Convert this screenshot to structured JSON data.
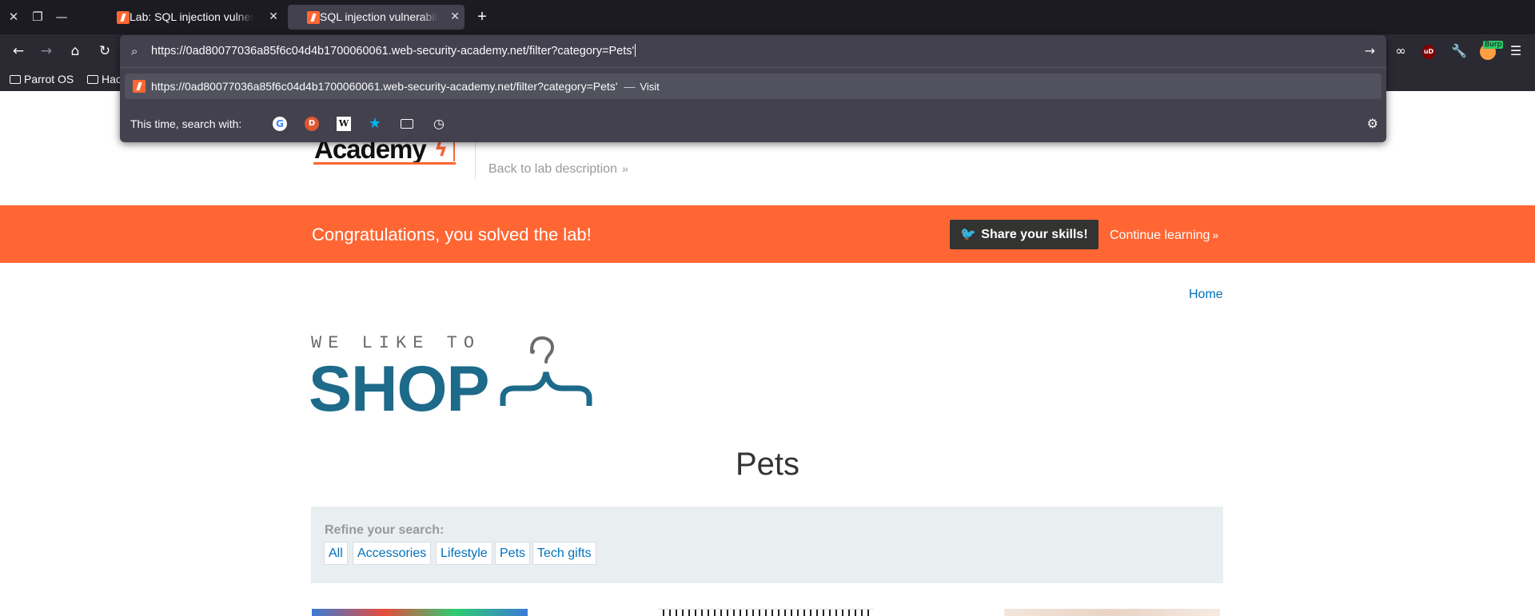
{
  "browser": {
    "tabs": [
      {
        "title": "Lab: SQL injection vulnerability in WHERE clause",
        "active": false
      },
      {
        "title": "SQL injection vulnerability in WHERE clause",
        "active": true
      }
    ],
    "url": "https://0ad80077036a85f6c04d4b1700060061.web-security-academy.net/filter?category=Pets'",
    "suggestion": {
      "url": "https://0ad80077036a85f6c04d4b1700060061.web-security-academy.net/filter?category=Pets'",
      "separator": "—",
      "action": "Visit"
    },
    "search_with_label": "This time, search with:",
    "engines": [
      "google-icon",
      "duckduckgo-icon",
      "wikipedia-icon",
      "bookmarks-star-icon",
      "tabs-icon",
      "history-icon"
    ],
    "bookmarks": [
      {
        "label": "Parrot OS"
      },
      {
        "label": "Hac"
      }
    ],
    "extensions": {
      "burp_badge": "Burp",
      "ublock_badge": "uD"
    }
  },
  "page": {
    "academy_logo": "Academy",
    "back_to_lab": "Back to lab description",
    "banner": {
      "message": "Congratulations, you solved the lab!",
      "share_label": "Share your skills!",
      "continue_label": "Continue learning"
    },
    "nav": {
      "home": "Home"
    },
    "shop_logo": {
      "tagline": "WE LIKE TO",
      "name": "SHOP"
    },
    "category_title": "Pets",
    "refine": {
      "label": "Refine your search:",
      "categories": [
        "All",
        "Accessories",
        "Lifestyle",
        "Pets",
        "Tech gifts"
      ]
    }
  },
  "colors": {
    "accent": "#ff6633",
    "link": "#0071bc",
    "shop_blue": "#1d6a8a",
    "chrome_dark": "#1c1b22"
  }
}
